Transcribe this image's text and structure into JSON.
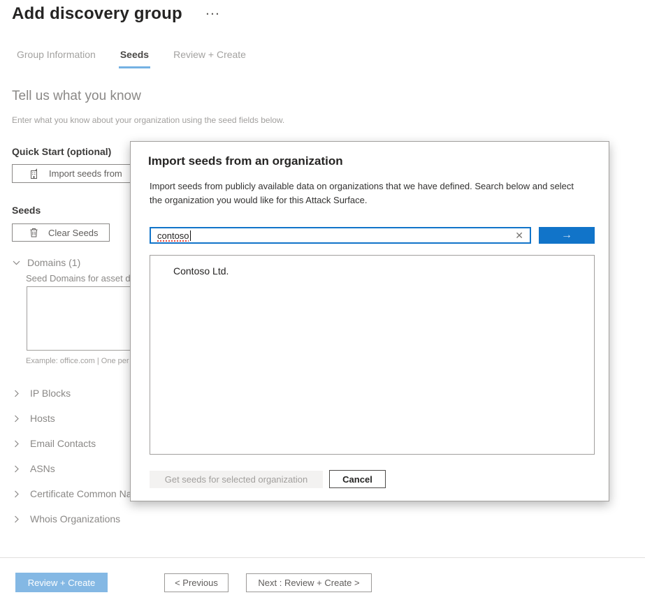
{
  "header": {
    "title": "Add discovery group",
    "more_label": "···"
  },
  "tabs": [
    {
      "label": "Group Information"
    },
    {
      "label": "Seeds"
    },
    {
      "label": "Review + Create"
    }
  ],
  "intro": {
    "heading": "Tell us what you know",
    "description": "Enter what you know about your organization using the seed fields below."
  },
  "quick_start": {
    "label": "Quick Start (optional)",
    "import_button": "Import seeds from"
  },
  "seeds": {
    "label": "Seeds",
    "clear_button": "Clear Seeds",
    "domains": {
      "label": "Domains (1)",
      "field_label": "Seed Domains for asset d",
      "value": "",
      "example": "Example: office.com | One per line"
    },
    "collapsed_sections": [
      {
        "label": "IP Blocks"
      },
      {
        "label": "Hosts"
      },
      {
        "label": "Email Contacts"
      },
      {
        "label": "ASNs"
      },
      {
        "label": "Certificate Common Name"
      },
      {
        "label": "Whois Organizations"
      }
    ]
  },
  "footer": {
    "review_create": "Review + Create",
    "previous": "< Previous",
    "next": "Next : Review + Create >"
  },
  "modal": {
    "title": "Import seeds from an organization",
    "description": "Import seeds from publicly available data on organizations that we have defined. Search below and select the organization you would like for this Attack Surface.",
    "search": {
      "value": "contoso",
      "clear_icon": "✕",
      "submit_icon": "→"
    },
    "results": [
      {
        "name": "Contoso Ltd."
      }
    ],
    "actions": {
      "get_seeds": "Get seeds for selected organization",
      "cancel": "Cancel"
    }
  },
  "colors": {
    "accent_blue": "#1174c9",
    "tab_underline": "#74b1e3",
    "primary_disabled_blue": "#84b8e4",
    "spellcheck_red": "#e0483e",
    "disabled_button_bg": "#f3f2f1"
  }
}
